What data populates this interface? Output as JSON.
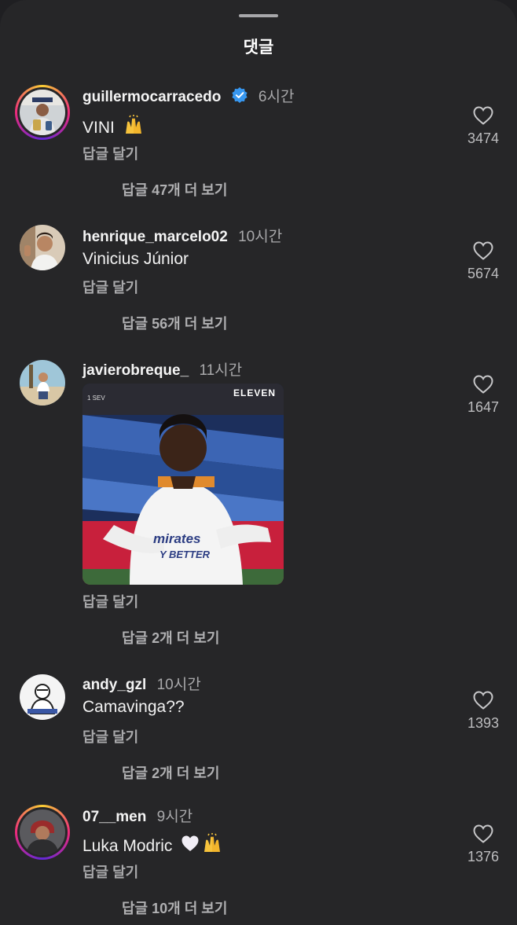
{
  "sheet": {
    "title": "댓글"
  },
  "comments": [
    {
      "username": "guillermocarracedo",
      "verified": true,
      "time": "6시간",
      "text": "VINI",
      "emoji": "raising-hands-icon",
      "reply_label": "답글 달기",
      "more_label": "답글 47개 더 보기",
      "likes": "3474",
      "story_ring": true
    },
    {
      "username": "henrique_marcelo02",
      "verified": false,
      "time": "10시간",
      "text": "Vinicius Júnior",
      "reply_label": "답글 달기",
      "more_label": "답글 56개 더 보기",
      "likes": "5674",
      "story_ring": false
    },
    {
      "username": "javierobreque_",
      "verified": false,
      "time": "11시간",
      "text": "",
      "media": {
        "type": "gif",
        "logo": "ELEVEN",
        "score": "1 SEV",
        "shirt": "mirates",
        "shirt2": "Y BETTER"
      },
      "reply_label": "답글 달기",
      "more_label": "답글 2개 더 보기",
      "likes": "1647",
      "story_ring": false
    },
    {
      "username": "andy_gzl",
      "verified": false,
      "time": "10시간",
      "text": "Camavinga??",
      "reply_label": "답글 달기",
      "more_label": "답글 2개 더 보기",
      "likes": "1393",
      "story_ring": false
    },
    {
      "username": "07__men",
      "verified": false,
      "time": "9시간",
      "text": "Luka Modric",
      "emoji": "white-heart-raising-hands-icon",
      "reply_label": "답글 달기",
      "more_label": "답글 10개 더 보기",
      "likes": "1376",
      "story_ring": true
    }
  ],
  "colors": {
    "background": "#262628",
    "secondary_text": "#a9a9ab",
    "verified_blue": "#3797f0"
  }
}
